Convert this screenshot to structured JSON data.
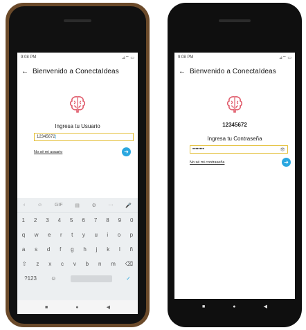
{
  "left": {
    "status": {
      "time": "9:08 PM",
      "icons": "⊿⌔ ▭"
    },
    "header": {
      "back": "←",
      "title": "Bienvenido a ConectaIdeas"
    },
    "prompt": "Ingresa tu Usuario",
    "input_value": "12345672",
    "forgot_link": "No sé mi usuario",
    "next": "➜",
    "keyboard": {
      "tools": [
        "‹",
        "☺",
        "GIF",
        "▤",
        "⚙",
        "···",
        "🎤"
      ],
      "rows": [
        [
          "1",
          "2",
          "3",
          "4",
          "5",
          "6",
          "7",
          "8",
          "9",
          "0"
        ],
        [
          "q",
          "w",
          "e",
          "r",
          "t",
          "y",
          "u",
          "i",
          "o",
          "p"
        ],
        [
          "a",
          "s",
          "d",
          "f",
          "g",
          "h",
          "j",
          "k",
          "l",
          "ñ"
        ],
        [
          "⇧",
          "z",
          "x",
          "c",
          "v",
          "b",
          "n",
          "m",
          "⌫"
        ],
        [
          "?123",
          "☺",
          "",
          "✓"
        ]
      ]
    },
    "nav": [
      "■",
      "●",
      "◀"
    ]
  },
  "right": {
    "status": {
      "time": "9:08 PM",
      "icons": "⊿⌔ ▭"
    },
    "header": {
      "back": "←",
      "title": "Bienvenido a ConectaIdeas"
    },
    "username": "12345672",
    "prompt": "Ingresa tu Contraseña",
    "password_value": "••••••••",
    "eye": "👁",
    "forgot_link": "No sé mi contraseña",
    "next": "➜",
    "nav": [
      "■",
      "●",
      "◀"
    ]
  },
  "colors": {
    "accent": "#2aa7e0",
    "field_border": "#e4c03a",
    "brain": "#e05a6a"
  },
  "icons": {
    "brain": "brain-logo-icon",
    "back": "back-arrow-icon",
    "next": "arrow-right-circle-icon",
    "eye": "eye-icon"
  }
}
